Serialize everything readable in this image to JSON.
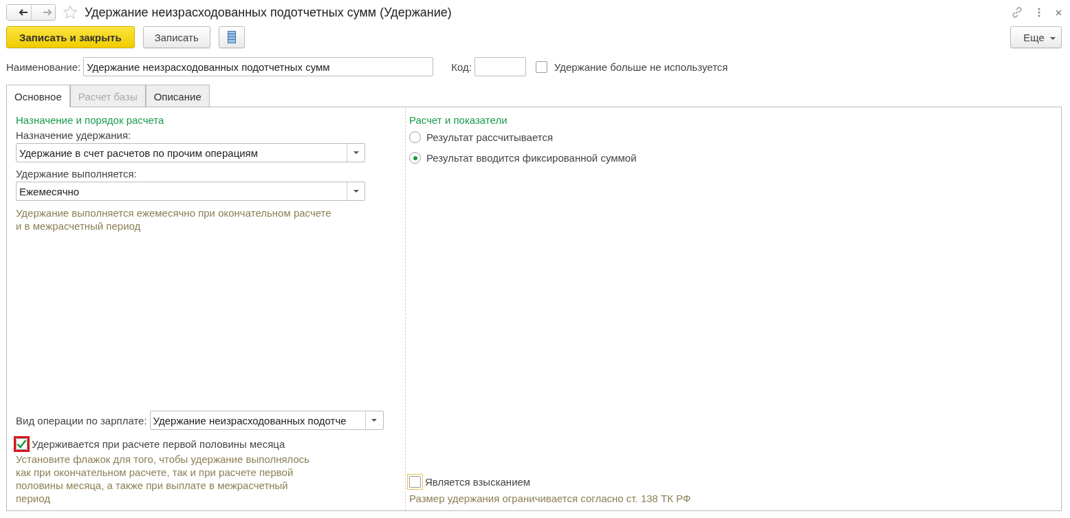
{
  "window": {
    "title": "Удержание неизрасходованных подотчетных сумм (Удержание)",
    "favorite": false
  },
  "toolbar": {
    "buttons": [
      {
        "label": "Записать и закрыть",
        "kind": "primary"
      },
      {
        "label": "Записать",
        "kind": "normal"
      }
    ],
    "more": "Еще"
  },
  "header": {
    "name_label": "Наименование:",
    "name_value": "Удержание неизрасходованных подотчетных сумм",
    "code_label": "Код:",
    "unused": {
      "label": "Удержание больше не используется",
      "checked": false
    }
  },
  "tabs": [
    {
      "label": "Основное",
      "selected": true,
      "disabled": false
    },
    {
      "label": "Расчет базы",
      "selected": false,
      "disabled": true
    },
    {
      "label": "Описание",
      "selected": false,
      "disabled": false
    }
  ],
  "left": {
    "title": "Назначение и порядок расчета",
    "fields": [
      {
        "label": "Назначение удержания:",
        "value": "Удержание в счет расчетов по прочим операциям"
      },
      {
        "label": "Удержание выполняется:",
        "value": "Ежемесячно"
      }
    ],
    "hint": "Удержание выполняется ежемесячно при окончательном расчете и в межрасчетный период",
    "operation": {
      "label": "Вид операции по зарплате:",
      "value": "Удержание неизрасходованных подотче"
    },
    "half_month": {
      "label": "Удерживается при расчете первой половины месяца",
      "checked": true,
      "marked": true
    },
    "half_month_hint": "Установите флажок для того, чтобы удержание выполнялось как при окончательном расчете, так и при расчете первой половины месяца, а также при выплате в межрасчетный период"
  },
  "right": {
    "title": "Расчет и показатели",
    "options": [
      {
        "label": "Результат рассчитывается",
        "selected": false
      },
      {
        "label": "Результат вводится фиксированной суммой",
        "selected": true
      }
    ],
    "penalty": {
      "label": "Является взысканием",
      "checked": false,
      "focused": true
    },
    "penalty_note": "Размер удержания ограничивается согласно ст. 138 ТК РФ"
  }
}
